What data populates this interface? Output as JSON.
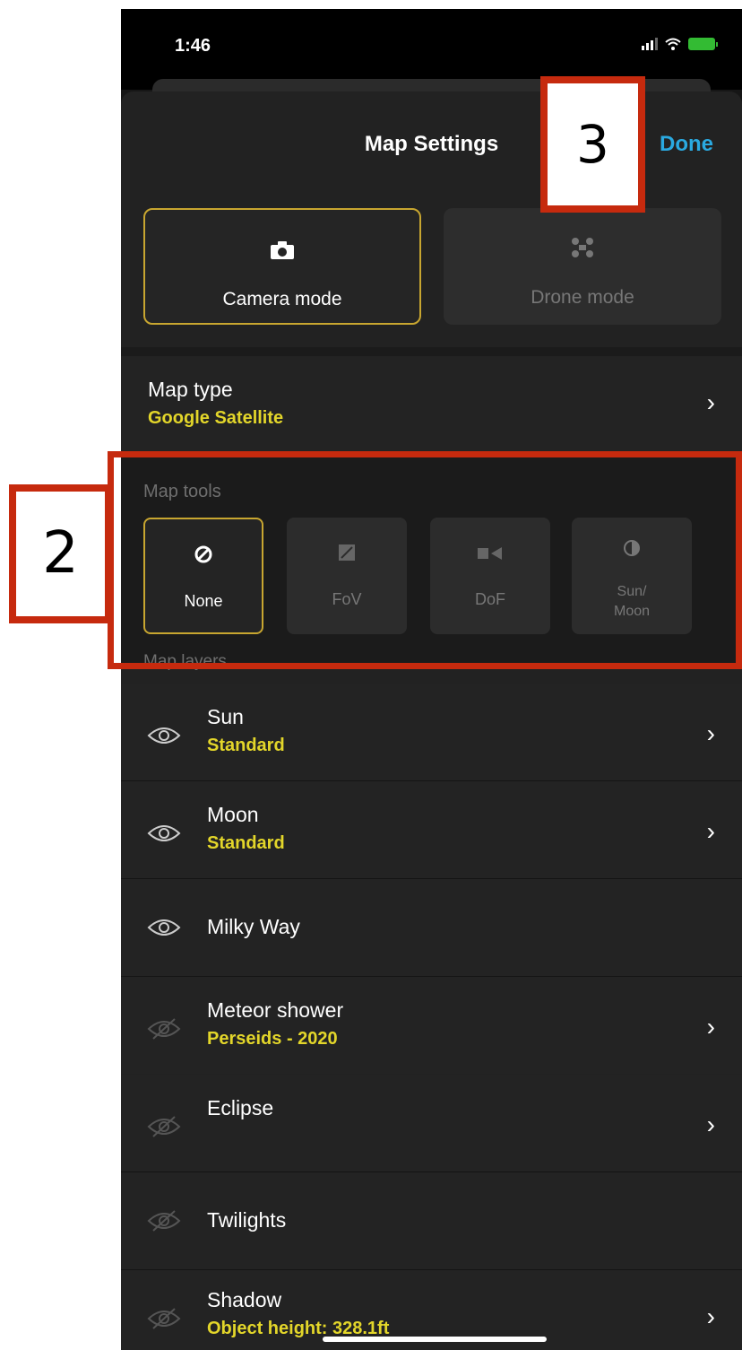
{
  "status_bar": {
    "time": "1:46"
  },
  "header": {
    "title": "Map Settings",
    "done_label": "Done"
  },
  "modes": [
    {
      "label": "Camera mode",
      "icon": "camera-icon",
      "selected": true
    },
    {
      "label": "Drone mode",
      "icon": "drone-icon",
      "selected": false
    }
  ],
  "map_type": {
    "label": "Map type",
    "value": "Google Satellite"
  },
  "map_tools": {
    "section_label": "Map tools",
    "items": [
      {
        "label": "None",
        "icon": "none-icon",
        "selected": true
      },
      {
        "label": "FoV",
        "icon": "fov-icon",
        "selected": false
      },
      {
        "label": "DoF",
        "icon": "dof-icon",
        "selected": false
      },
      {
        "label": "Sun/\nMoon",
        "icon": "sun-moon-icon",
        "selected": false
      }
    ]
  },
  "map_layers": {
    "section_label": "Map layers",
    "items": [
      {
        "label": "Sun",
        "value": "Standard",
        "visible": true
      },
      {
        "label": "Moon",
        "value": "Standard",
        "visible": true
      },
      {
        "label": "Milky Way",
        "value": "",
        "visible": true
      },
      {
        "label": "Meteor shower",
        "value": "Perseids - 2020",
        "visible": false
      },
      {
        "label": "Eclipse",
        "value": "",
        "visible": false
      },
      {
        "label": "Twilights",
        "value": "",
        "visible": false
      },
      {
        "label": "Shadow",
        "value": "Object height: 328.1ft",
        "visible": false
      }
    ]
  },
  "annotations": [
    {
      "number": "2"
    },
    {
      "number": "3"
    }
  ],
  "colors": {
    "accent_yellow": "#e3d62a",
    "done_blue": "#2aa9e0",
    "annotation_red": "#c62a0e"
  }
}
